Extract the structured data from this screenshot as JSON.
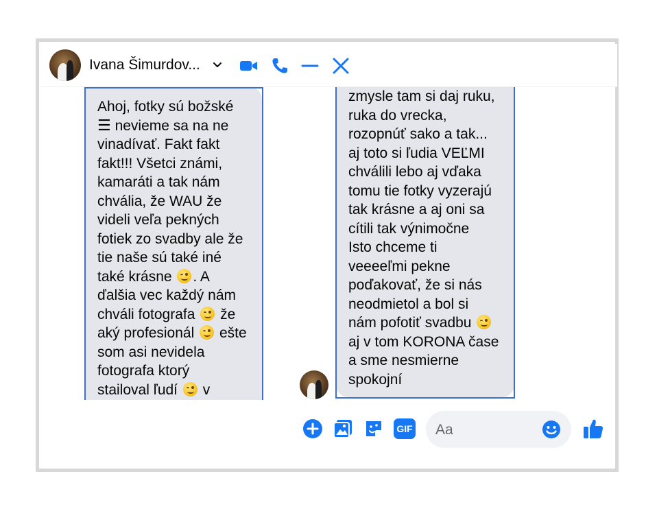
{
  "header": {
    "contact_name": "Ivana Šimurdov...",
    "icons": [
      "chevron-down-icon",
      "video-call-icon",
      "phone-icon",
      "minimize-icon",
      "close-icon"
    ]
  },
  "messages": {
    "left": {
      "lines": [
        "Ahoj, fotky sú božské",
        "nevieme sa na ne",
        "vinadívať. Fakt fakt",
        "fakt!!! Všetci známi,",
        "kamaráti a tak nám",
        "chvália, že WAU že",
        "videli veľa pekných",
        "fotiek zo svadby ale že",
        "tie naše sú také iné",
        "také krásne",
        ". A",
        "ďalšia vec každý nám",
        "chváli fotografa",
        "že",
        "aký profesionál",
        "ešte",
        "som asi nevidela",
        "fotografa ktorý",
        "stailoval ľudí",
        "v"
      ]
    },
    "right": {
      "lines": [
        "zmysle tam si daj ruku,",
        "ruka do vrecka,",
        "rozopnúť sako a tak...",
        "aj toto si ľudia VEĽMI",
        "chválili lebo aj vďaka",
        "tomu tie fotky vyzerajú",
        "tak krásne a aj oni sa",
        "cítili tak výnimočne",
        "Isto chceme ti",
        "veeeeľmi pekne",
        "poďakovať, že si nás",
        "neodmietol a bol si",
        "nám pofotiť svadbu",
        "aj v tom KORONA čase",
        "a sme nesmierne",
        "spokojní"
      ]
    }
  },
  "composer": {
    "placeholder": "Aa",
    "icons": [
      "add-icon",
      "photo-icon",
      "sticker-icon",
      "gif-icon",
      "emoji-icon",
      "like-icon"
    ],
    "gif_label": "GIF"
  },
  "colors": {
    "accent": "#1877f2",
    "bubble": "#e4e6eb",
    "selection": "#3b6fd8",
    "frame": "#d8d8d8"
  }
}
